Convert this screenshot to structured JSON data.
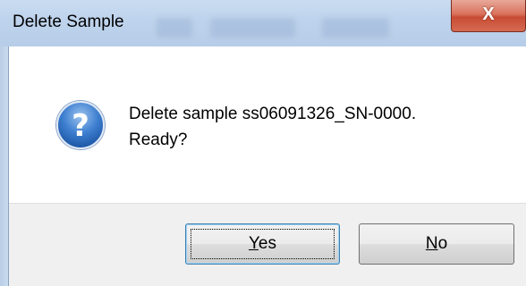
{
  "window": {
    "title": "Delete Sample",
    "close_glyph": "X"
  },
  "message": {
    "line1": "Delete sample ss06091326_SN-0000.",
    "line2": "Ready?",
    "icon": "question-icon"
  },
  "buttons": {
    "yes": {
      "mnemonic": "Y",
      "rest": "es"
    },
    "no": {
      "mnemonic": "N",
      "rest": "o"
    }
  },
  "colors": {
    "titlebar": "#bed3ec",
    "close": "#c94c34",
    "icon": "#3e7fd0",
    "footer": "#f0f0f0"
  }
}
